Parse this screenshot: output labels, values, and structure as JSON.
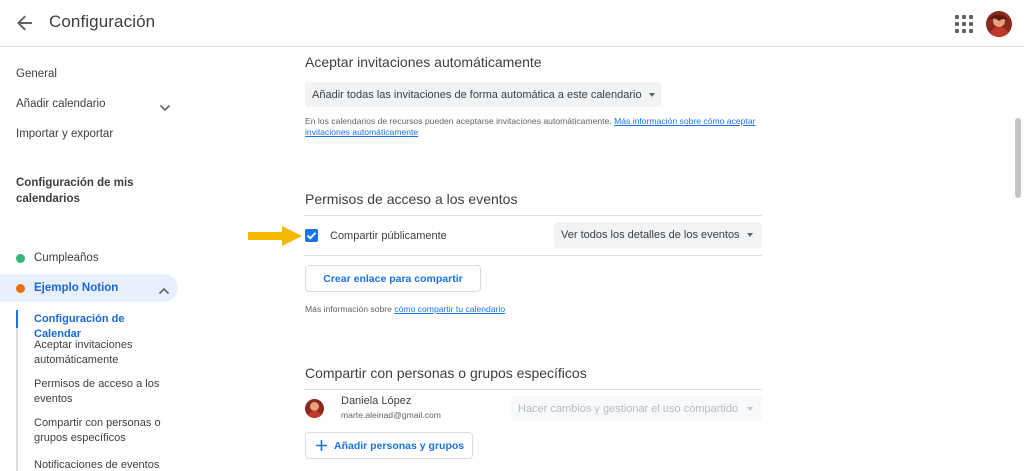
{
  "header": {
    "title": "Configuración",
    "back_icon": "arrow-back-icon",
    "apps_icon": "apps-grid-icon"
  },
  "sidebar": {
    "items": [
      {
        "label": "General"
      },
      {
        "label": "Añadir calendario"
      },
      {
        "label": "Importar y exportar"
      }
    ],
    "section_title": "Configuración de mis calendarios",
    "calendars": [
      {
        "label": "Cumpleaños",
        "color": "#33b679"
      },
      {
        "label": "Ejemplo Notion",
        "color": "#e8710a"
      }
    ],
    "sub_items": [
      {
        "label": "Configuración de Calendar"
      },
      {
        "label": "Aceptar invitaciones automáticamente"
      },
      {
        "label": "Permisos de acceso a los eventos"
      },
      {
        "label": "Compartir con personas o grupos específicos"
      },
      {
        "label": "Notificaciones de eventos"
      }
    ]
  },
  "auto_accept": {
    "title": "Aceptar invitaciones automáticamente",
    "select_value": "Añadir todas las invitaciones de forma automática a este calendario",
    "help_text": "En los calendarios de recursos pueden aceptarse invitaciones automáticamente.",
    "help_link": "Más información sobre cómo aceptar invitaciones automáticamente"
  },
  "permissions": {
    "title": "Permisos de acceso a los eventos",
    "public_label": "Compartir públicamente",
    "public_checked": true,
    "detail_select": "Ver todos los detalles de los eventos",
    "share_link_button": "Crear enlace para compartir",
    "help_prefix": "Más información sobre",
    "help_link": "cómo compartir tu calendario"
  },
  "sharing": {
    "title": "Compartir con personas o grupos específicos",
    "person_name": "Daniela López",
    "person_email": "marte.aleinad@gmail.com",
    "person_permission": "Hacer cambios y gestionar el uso compartido",
    "add_button": "Añadir personas y grupos"
  },
  "colors": {
    "accent": "#1a73e8",
    "arrow": "#f5b800"
  }
}
